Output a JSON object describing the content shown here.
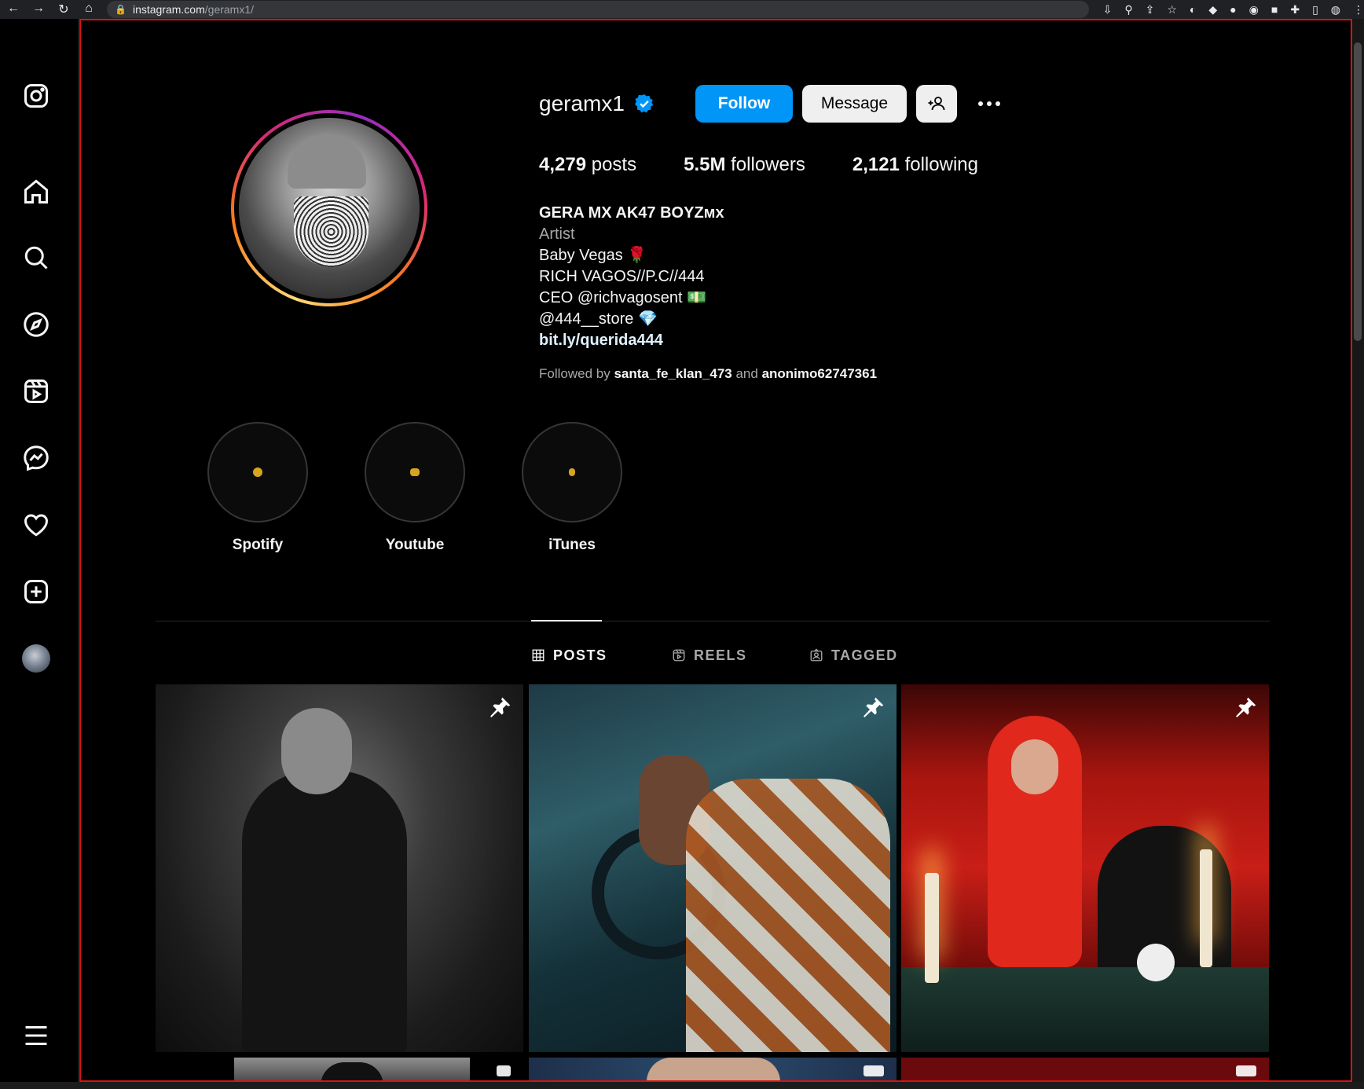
{
  "browser": {
    "url_host": "instagram.com",
    "url_path": "/geramx1/"
  },
  "sidebar": {
    "items": [
      {
        "name": "instagram-logo-icon"
      },
      {
        "name": "home-icon"
      },
      {
        "name": "search-icon"
      },
      {
        "name": "explore-icon"
      },
      {
        "name": "reels-icon"
      },
      {
        "name": "messenger-icon"
      },
      {
        "name": "heart-icon"
      },
      {
        "name": "create-icon"
      },
      {
        "name": "avatar"
      },
      {
        "name": "menu-icon"
      }
    ]
  },
  "profile": {
    "username": "geramx1",
    "verified": true,
    "follow_label": "Follow",
    "message_label": "Message",
    "stats": {
      "posts_count": "4,279",
      "posts_label": "posts",
      "followers_count": "5.5M",
      "followers_label": "followers",
      "following_count": "2,121",
      "following_label": "following"
    },
    "bio": {
      "full_name": "GERA MX AK47 BOYZᴍx",
      "category": "Artist",
      "lines": [
        "Baby Vegas 🌹",
        "RICH VAGOS//P.C//444",
        "CEO @richvagosent 💵",
        "@444__store 💎"
      ],
      "link": "bit.ly/querida444"
    },
    "followed_by": {
      "prefix": "Followed by",
      "user1": "santa_fe_klan_473",
      "connector": "and",
      "user2": "anonimo62747361"
    }
  },
  "highlights": [
    {
      "label": "Spotify"
    },
    {
      "label": "Youtube"
    },
    {
      "label": "iTunes"
    }
  ],
  "tabs": [
    {
      "label": "POSTS",
      "active": true
    },
    {
      "label": "REELS",
      "active": false
    },
    {
      "label": "TAGGED",
      "active": false
    }
  ],
  "colors": {
    "follow_button": "#0095f6",
    "verified_badge": "#0095f6",
    "background": "#000000"
  }
}
